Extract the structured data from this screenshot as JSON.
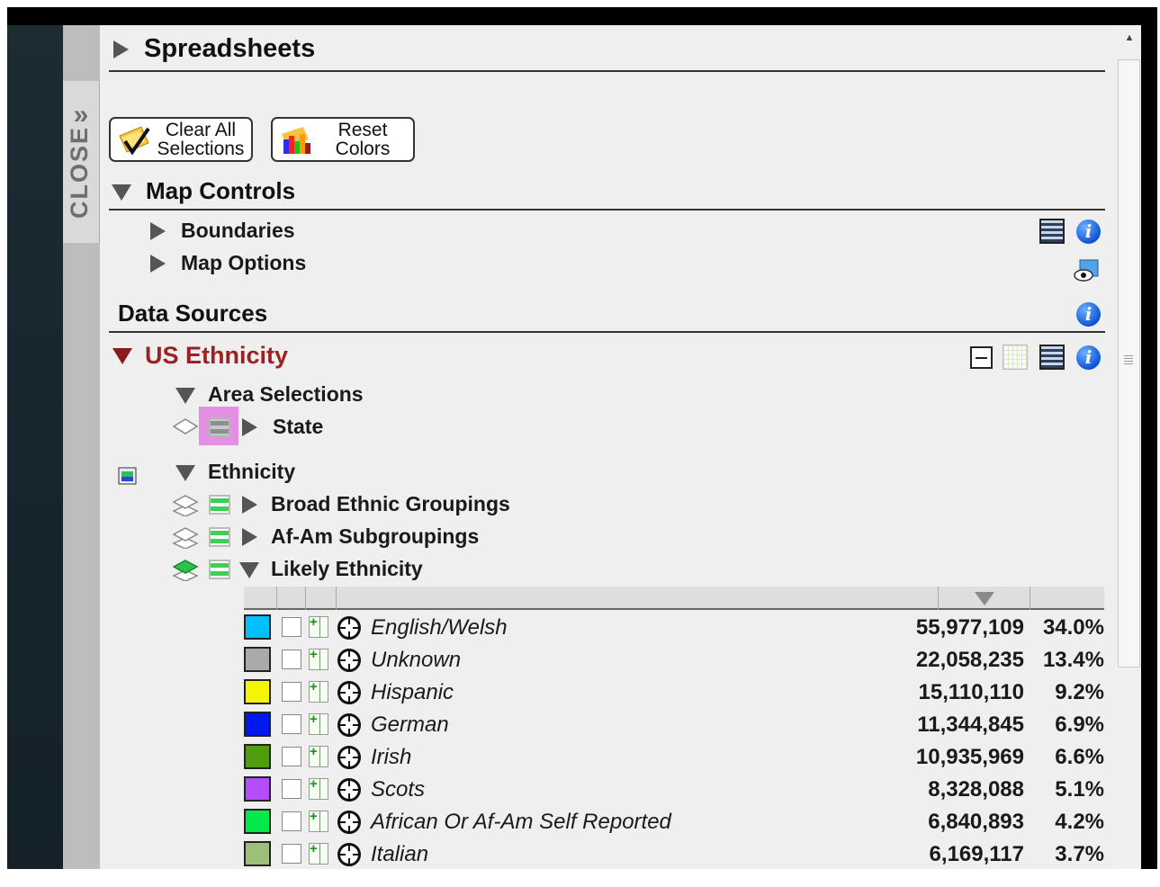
{
  "close_tab": {
    "label": "CLOSE"
  },
  "spreadsheets": {
    "title": "Spreadsheets"
  },
  "buttons": {
    "clear_all": "Clear All Selections",
    "clear_all_line1": "Clear All",
    "clear_all_line2": "Selections",
    "reset": "Reset Colors",
    "reset_line1": "Reset",
    "reset_line2": "Colors"
  },
  "map_controls": {
    "title": "Map Controls",
    "items": [
      {
        "label": "Boundaries"
      },
      {
        "label": "Map Options"
      }
    ]
  },
  "data_sources": {
    "title": "Data Sources"
  },
  "us_ethnicity": {
    "title": "US Ethnicity",
    "area_selections": {
      "label": "Area Selections",
      "state": "State"
    },
    "ethnicity": {
      "label": "Ethnicity",
      "layers": [
        {
          "label": "Broad Ethnic Groupings"
        },
        {
          "label": "Af-Am Subgroupings"
        },
        {
          "label": "Likely Ethnicity"
        }
      ]
    }
  },
  "likely_ethnicity": {
    "rows": [
      {
        "name": "English/Welsh",
        "count": "55,977,109",
        "pct": "34.0%",
        "color": "#00bfff"
      },
      {
        "name": "Unknown",
        "count": "22,058,235",
        "pct": "13.4%",
        "color": "#aaaaaa"
      },
      {
        "name": "Hispanic",
        "count": "15,110,110",
        "pct": "9.2%",
        "color": "#f5f500"
      },
      {
        "name": "German",
        "count": "11,344,845",
        "pct": "6.9%",
        "color": "#0018f0"
      },
      {
        "name": "Irish",
        "count": "10,935,969",
        "pct": "6.6%",
        "color": "#4f9e0f"
      },
      {
        "name": "Scots",
        "count": "8,328,088",
        "pct": "5.1%",
        "color": "#b34dff"
      },
      {
        "name": "African Or Af-Am Self Reported",
        "count": "6,840,893",
        "pct": "4.2%",
        "color": "#00e84a"
      },
      {
        "name": "Italian",
        "count": "6,169,117",
        "pct": "3.7%",
        "color": "#9cc07a"
      }
    ]
  },
  "icons": [
    "close-chevron-icon",
    "clear-selections-icon",
    "reset-colors-icon",
    "film-icon",
    "info-icon",
    "legend-eye-icon",
    "collapse-icon",
    "grid-icon",
    "layer-icon",
    "table-icon",
    "add-column-icon",
    "target-icon",
    "sort-desc-icon"
  ]
}
